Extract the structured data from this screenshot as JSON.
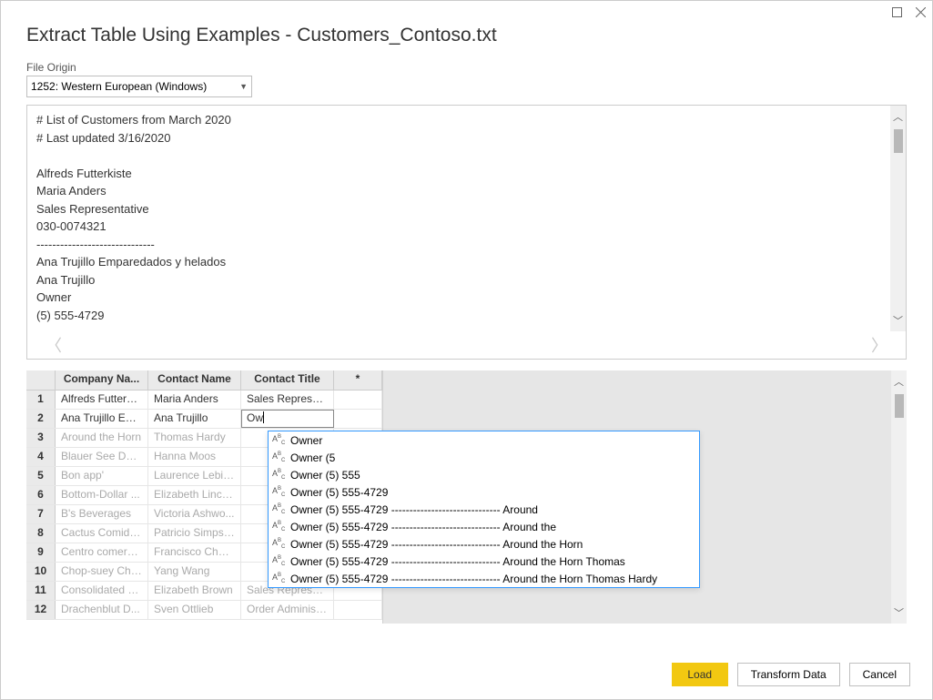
{
  "window": {
    "title": "Extract Table Using Examples - Customers_Contoso.txt"
  },
  "file_origin": {
    "label": "File Origin",
    "value": "1252: Western European (Windows)"
  },
  "preview_lines": [
    "# List of Customers from March 2020",
    "# Last updated 3/16/2020",
    "",
    "Alfreds Futterkiste",
    "Maria Anders",
    "Sales Representative",
    "030-0074321",
    "------------------------------",
    "Ana Trujillo Emparedados y helados",
    "Ana Trujillo",
    "Owner",
    "(5) 555-4729",
    "------------------------------"
  ],
  "grid": {
    "headers": [
      "Company Na...",
      "Contact Name",
      "Contact Title",
      "*"
    ],
    "editing_value": "Ow",
    "rows": [
      {
        "num": "1",
        "company": "Alfreds Futterki...",
        "contact": "Maria Anders",
        "title": "Sales Represen...",
        "ghost": false
      },
      {
        "num": "2",
        "company": "Ana Trujillo Em...",
        "contact": "Ana Trujillo",
        "title": "",
        "ghost": false,
        "editing": true
      },
      {
        "num": "3",
        "company": "Around the Horn",
        "contact": "Thomas Hardy",
        "title": "",
        "ghost": true
      },
      {
        "num": "4",
        "company": "Blauer See Deli...",
        "contact": "Hanna Moos",
        "title": "",
        "ghost": true
      },
      {
        "num": "5",
        "company": "Bon app'",
        "contact": "Laurence Lebih...",
        "title": "",
        "ghost": true
      },
      {
        "num": "6",
        "company": "Bottom-Dollar ...",
        "contact": "Elizabeth Lincoln",
        "title": "",
        "ghost": true
      },
      {
        "num": "7",
        "company": "B's Beverages",
        "contact": "Victoria Ashwo...",
        "title": "",
        "ghost": true
      },
      {
        "num": "8",
        "company": "Cactus Comida...",
        "contact": "Patricio Simpson",
        "title": "",
        "ghost": true
      },
      {
        "num": "9",
        "company": "Centro comerci...",
        "contact": "Francisco Chang",
        "title": "",
        "ghost": true
      },
      {
        "num": "10",
        "company": "Chop-suey Chi...",
        "contact": "Yang Wang",
        "title": "",
        "ghost": true
      },
      {
        "num": "11",
        "company": "Consolidated H...",
        "contact": "Elizabeth Brown",
        "title": "Sales Represen...",
        "ghost": true
      },
      {
        "num": "12",
        "company": "Drachenblut D...",
        "contact": "Sven Ottlieb",
        "title": "Order Administ...",
        "ghost": true
      }
    ]
  },
  "suggestions": [
    "Owner",
    "Owner (5",
    "Owner (5) 555",
    "Owner (5) 555-4729",
    "Owner (5) 555-4729 ------------------------------ Around",
    "Owner (5) 555-4729 ------------------------------ Around the",
    "Owner (5) 555-4729 ------------------------------ Around the Horn",
    "Owner (5) 555-4729 ------------------------------ Around the Horn Thomas",
    "Owner (5) 555-4729 ------------------------------ Around the Horn Thomas Hardy"
  ],
  "footer": {
    "load": "Load",
    "transform": "Transform Data",
    "cancel": "Cancel"
  }
}
